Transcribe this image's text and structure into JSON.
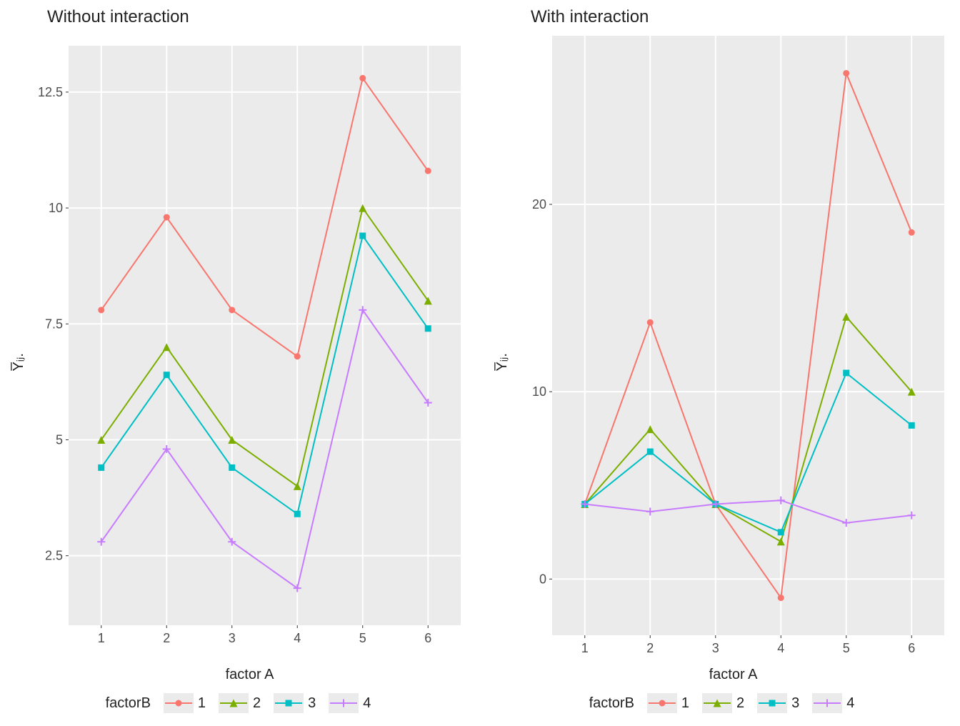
{
  "colors": {
    "s1": "#F8766D",
    "s2": "#7CAE00",
    "s3": "#00BFC4",
    "s4": "#C77CFF",
    "panel": "#EBEBEB",
    "gridMajor": "#FFFFFF",
    "axisText": "#4D4D4D"
  },
  "legend": {
    "title": "factorB",
    "items": [
      "1",
      "2",
      "3",
      "4"
    ]
  },
  "axisX": {
    "label": "factor A",
    "categories": [
      "1",
      "2",
      "3",
      "4",
      "5",
      "6"
    ]
  },
  "axisY": {
    "label": "Y̅ᵢⱼ."
  },
  "chart_data": [
    {
      "title": "Without interaction",
      "type": "line",
      "xlabel": "factor A",
      "ylabel": "Y̅ᵢⱼ.",
      "categories": [
        "1",
        "2",
        "3",
        "4",
        "5",
        "6"
      ],
      "ylim": [
        1.0,
        13.5
      ],
      "yticks": [
        2.5,
        5.0,
        7.5,
        10.0,
        12.5
      ],
      "series": [
        {
          "name": "1",
          "shape": "circle",
          "values": [
            7.8,
            9.8,
            7.8,
            6.8,
            12.8,
            10.8
          ]
        },
        {
          "name": "2",
          "shape": "triangle",
          "values": [
            5.0,
            7.0,
            5.0,
            4.0,
            10.0,
            8.0
          ]
        },
        {
          "name": "3",
          "shape": "square",
          "values": [
            4.4,
            6.4,
            4.4,
            3.4,
            9.4,
            7.4
          ]
        },
        {
          "name": "4",
          "shape": "plus",
          "values": [
            2.8,
            4.8,
            2.8,
            1.8,
            7.8,
            5.8
          ]
        }
      ]
    },
    {
      "title": "With interaction",
      "type": "line",
      "xlabel": "factor A",
      "ylabel": "Y̅ᵢⱼ.",
      "categories": [
        "1",
        "2",
        "3",
        "4",
        "5",
        "6"
      ],
      "ylim": [
        -3,
        29
      ],
      "yticks": [
        0,
        10,
        20
      ],
      "series": [
        {
          "name": "1",
          "shape": "circle",
          "values": [
            4.0,
            13.7,
            4.0,
            -1.0,
            27.0,
            18.5
          ]
        },
        {
          "name": "2",
          "shape": "triangle",
          "values": [
            4.0,
            8.0,
            4.0,
            2.0,
            14.0,
            10.0
          ]
        },
        {
          "name": "3",
          "shape": "square",
          "values": [
            4.0,
            6.8,
            4.0,
            2.5,
            11.0,
            8.2
          ]
        },
        {
          "name": "4",
          "shape": "plus",
          "values": [
            4.0,
            3.6,
            4.0,
            4.2,
            3.0,
            3.4
          ]
        }
      ]
    }
  ]
}
